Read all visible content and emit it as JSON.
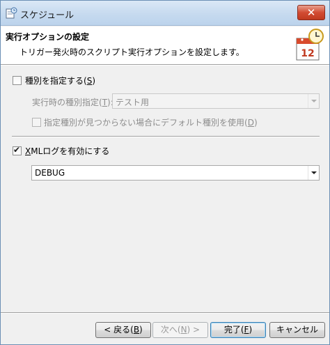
{
  "window": {
    "title": "スケジュール",
    "close_label": "✕"
  },
  "header": {
    "title": "実行オプションの設定",
    "subtitle": "トリガー発火時のスクリプト実行オプションを設定します。",
    "calendar_day": "12"
  },
  "specify_type": {
    "checked": false,
    "label": "種別を指定する(",
    "mnemonic": "S",
    "label_end": ")"
  },
  "run_type": {
    "label": "実行時の種別指定(",
    "mnemonic": "T",
    "label_end": "):",
    "value": "テスト用",
    "enabled": false
  },
  "fallback_default": {
    "checked": false,
    "label": "指定種別が見つからない場合にデフォルト種別を使用(",
    "mnemonic": "D",
    "label_end": ")",
    "enabled": false
  },
  "xml_log": {
    "checked": true,
    "mnemonic": "X",
    "label_rest": "MLログを有効にする"
  },
  "log_level": {
    "value": "DEBUG"
  },
  "buttons": {
    "back": {
      "label": "< 戻る(",
      "mnemonic": "B",
      "label_end": ")"
    },
    "next": {
      "label": "次へ(",
      "mnemonic": "N",
      "label_end": ") >"
    },
    "finish": {
      "label": "完了(",
      "mnemonic": "F",
      "label_end": ")"
    },
    "cancel": {
      "label": "キャンセル"
    }
  }
}
